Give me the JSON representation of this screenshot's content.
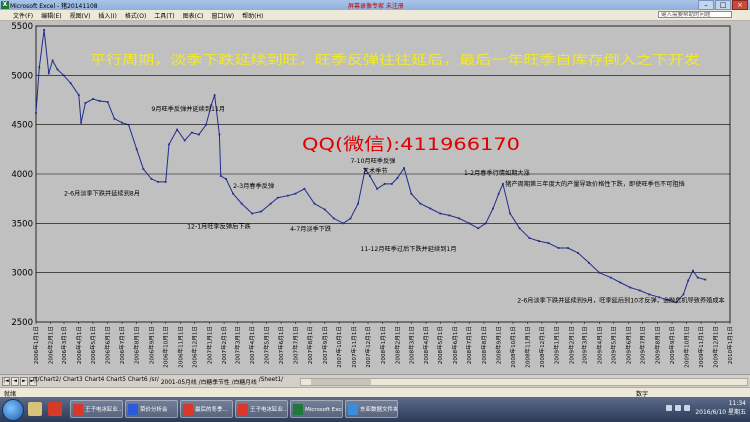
{
  "window": {
    "title": "Microsoft Excel - 猪20141108",
    "title_extra": "屏幕录像专家  未注册",
    "controls": {
      "minimize": "–",
      "maximize": "□",
      "close": "×"
    }
  },
  "menu": {
    "items": [
      "文件(F)",
      "编辑(E)",
      "视图(V)",
      "插入(I)",
      "格式(O)",
      "工具(T)",
      "图表(C)",
      "窗口(W)",
      "帮助(H)"
    ],
    "help_placeholder": "键入需要帮助的问题"
  },
  "chart_data": {
    "type": "line",
    "title": "",
    "xlabel": "",
    "ylabel": "",
    "ylim": [
      2500,
      5500
    ],
    "yticks": [
      2500,
      3000,
      3500,
      4000,
      4500,
      5000,
      5500
    ],
    "xticks": [
      "2006年1月1日",
      "2006年2月1日",
      "2006年3月1日",
      "2006年4月1日",
      "2006年5月1日",
      "2006年6月1日",
      "2006年7月1日",
      "2006年8月1日",
      "2006年9月1日",
      "2006年10月1日",
      "2006年11月1日",
      "2006年12月1日",
      "2007年1月1日",
      "2007年2月1日",
      "2007年3月1日",
      "2007年4月1日",
      "2007年5月1日",
      "2007年6月1日",
      "2007年7月1日",
      "2007年8月1日",
      "2007年9月1日",
      "2007年10月1日",
      "2007年11月1日",
      "2007年12月1日",
      "2008年1月1日",
      "2008年2月1日",
      "2008年3月1日",
      "2008年4月1日",
      "2008年5月1日",
      "2008年6月1日",
      "2008年7月1日",
      "2008年8月1日",
      "2008年9月1日",
      "2008年10月1日",
      "2008年11月1日",
      "2008年12月1日",
      "2009年1月1日",
      "2009年2月1日",
      "2009年3月1日",
      "2009年4月1日",
      "2009年5月1日",
      "2009年6月1日",
      "2009年7月1日",
      "2009年8月1日",
      "2009年9月1日",
      "2009年10月1日",
      "2009年11月1日",
      "2009年12月1日",
      "2010年1月1日"
    ],
    "series": [
      {
        "color": "#1f2d8a",
        "points": [
          [
            "2006-01-01",
            4620
          ],
          [
            "2006-01-08",
            5080
          ],
          [
            "2006-01-18",
            5460
          ],
          [
            "2006-01-28",
            5020
          ],
          [
            "2006-02-05",
            5150
          ],
          [
            "2006-02-15",
            5060
          ],
          [
            "2006-02-28",
            5000
          ],
          [
            "2006-03-15",
            4920
          ],
          [
            "2006-04-01",
            4800
          ],
          [
            "2006-04-06",
            4520
          ],
          [
            "2006-04-15",
            4720
          ],
          [
            "2006-05-01",
            4760
          ],
          [
            "2006-05-15",
            4740
          ],
          [
            "2006-06-01",
            4730
          ],
          [
            "2006-06-15",
            4560
          ],
          [
            "2006-07-01",
            4520
          ],
          [
            "2006-07-15",
            4500
          ],
          [
            "2006-08-01",
            4250
          ],
          [
            "2006-08-15",
            4050
          ],
          [
            "2006-09-01",
            3950
          ],
          [
            "2006-09-15",
            3920
          ],
          [
            "2006-10-01",
            3920
          ],
          [
            "2006-10-08",
            4300
          ],
          [
            "2006-10-25",
            4450
          ],
          [
            "2006-11-10",
            4340
          ],
          [
            "2006-11-25",
            4420
          ],
          [
            "2006-12-10",
            4400
          ],
          [
            "2006-12-25",
            4500
          ],
          [
            "2007-01-05",
            4700
          ],
          [
            "2007-01-12",
            4800
          ],
          [
            "2007-01-22",
            4400
          ],
          [
            "2007-01-25",
            3980
          ],
          [
            "2007-02-05",
            3950
          ],
          [
            "2007-02-20",
            3800
          ],
          [
            "2007-03-10",
            3700
          ],
          [
            "2007-04-01",
            3600
          ],
          [
            "2007-04-20",
            3620
          ],
          [
            "2007-05-10",
            3700
          ],
          [
            "2007-05-25",
            3760
          ],
          [
            "2007-06-15",
            3780
          ],
          [
            "2007-07-01",
            3800
          ],
          [
            "2007-07-20",
            3850
          ],
          [
            "2007-08-10",
            3700
          ],
          [
            "2007-09-01",
            3640
          ],
          [
            "2007-09-20",
            3550
          ],
          [
            "2007-10-10",
            3500
          ],
          [
            "2007-10-25",
            3550
          ],
          [
            "2007-11-10",
            3700
          ],
          [
            "2007-11-25",
            4050
          ],
          [
            "2007-12-05",
            3980
          ],
          [
            "2007-12-20",
            3850
          ],
          [
            "2008-01-05",
            3900
          ],
          [
            "2008-01-20",
            3900
          ],
          [
            "2008-02-01",
            3960
          ],
          [
            "2008-02-15",
            4060
          ],
          [
            "2008-03-01",
            3800
          ],
          [
            "2008-03-20",
            3700
          ],
          [
            "2008-04-10",
            3650
          ],
          [
            "2008-05-01",
            3600
          ],
          [
            "2008-05-20",
            3580
          ],
          [
            "2008-06-10",
            3550
          ],
          [
            "2008-07-01",
            3500
          ],
          [
            "2008-07-20",
            3450
          ],
          [
            "2008-08-05",
            3500
          ],
          [
            "2008-08-20",
            3650
          ],
          [
            "2008-09-01",
            3800
          ],
          [
            "2008-09-10",
            3900
          ],
          [
            "2008-09-25",
            3600
          ],
          [
            "2008-10-15",
            3450
          ],
          [
            "2008-11-05",
            3350
          ],
          [
            "2008-11-25",
            3320
          ],
          [
            "2008-12-15",
            3300
          ],
          [
            "2009-01-05",
            3250
          ],
          [
            "2009-01-25",
            3250
          ],
          [
            "2009-02-15",
            3200
          ],
          [
            "2009-03-10",
            3100
          ],
          [
            "2009-04-01",
            3000
          ],
          [
            "2009-04-25",
            2950
          ],
          [
            "2009-05-15",
            2900
          ],
          [
            "2009-06-05",
            2850
          ],
          [
            "2009-06-25",
            2820
          ],
          [
            "2009-07-15",
            2780
          ],
          [
            "2009-08-05",
            2750
          ],
          [
            "2009-08-25",
            2720
          ],
          [
            "2009-09-10",
            2700
          ],
          [
            "2009-09-25",
            2780
          ],
          [
            "2009-10-05",
            2920
          ],
          [
            "2009-10-15",
            3020
          ],
          [
            "2009-10-25",
            2950
          ],
          [
            "2009-11-10",
            2930
          ]
        ]
      }
    ],
    "annotations": [
      {
        "text": "2-6月淡季下跌并延续到8月",
        "date": "2006-03-01",
        "value": 3780,
        "color": "#000000"
      },
      {
        "text": "9月旺季反弹并延续到11月",
        "date": "2006-09-01",
        "value": 4640,
        "color": "#000000"
      },
      {
        "text": "12-1月旺季反弹后下跌",
        "date": "2006-11-15",
        "value": 3450,
        "color": "#000000"
      },
      {
        "text": "2-3月春季反弹",
        "date": "2007-02-20",
        "value": 3860,
        "color": "#000000"
      },
      {
        "text": "4-7月淡季下跌",
        "date": "2007-06-20",
        "value": 3420,
        "color": "#000000"
      },
      {
        "text": "7-10月旺季反弹",
        "date": "2007-10-25",
        "value": 4110,
        "color": "#000000"
      },
      {
        "text": "艺术季节",
        "date": "2007-11-20",
        "value": 4010,
        "color": "#000000"
      },
      {
        "text": "11-12月旺季过后下跌并延续到1月",
        "date": "2007-11-15",
        "value": 3220,
        "color": "#000000"
      },
      {
        "text": "1-2月春季行情如期大涨",
        "date": "2008-06-20",
        "value": 3990,
        "color": "#000000"
      },
      {
        "text": "猪产周期第三年度大的产量导致价格性下跌，即使旺季也不可阻挡",
        "date": "2008-09-15",
        "value": 3880,
        "color": "#000000"
      },
      {
        "text": "2-6月淡季下跌并延续到9月，旺季延后到10才反弹，金融危机导致养殖成本",
        "date": "2008-10-10",
        "value": 2700,
        "color": "#000000"
      }
    ]
  },
  "overlays": {
    "yellow_banner": "平行周期，淡季下跌延续到旺，旺季反弹往往延后，最后一年旺季自库存倒入之下开发",
    "qq_text": "QQ(微信):411966170"
  },
  "sheet_tabs": {
    "visible": [
      ".rt/Chart2/",
      "Chart3",
      "Chart4",
      "Chart5",
      "Chart6",
      "/sr/",
      "2001-05月线",
      "/白糖季节性",
      "/白糖月线",
      "/Sheet1/"
    ],
    "nav": [
      "|◄",
      "◄",
      "►",
      "►|"
    ]
  },
  "status": {
    "ready": "就绪",
    "num": "数字"
  },
  "taskbar": {
    "tasks": [
      "王子电冰缸业...",
      "菜价分析会",
      "最后的冬季...",
      "王子电冰缸业...",
      "Microsoft Excel...",
      "东亚数据文件夹"
    ],
    "clock_time": "11:34",
    "clock_date": "2016/6/10 星期五"
  }
}
